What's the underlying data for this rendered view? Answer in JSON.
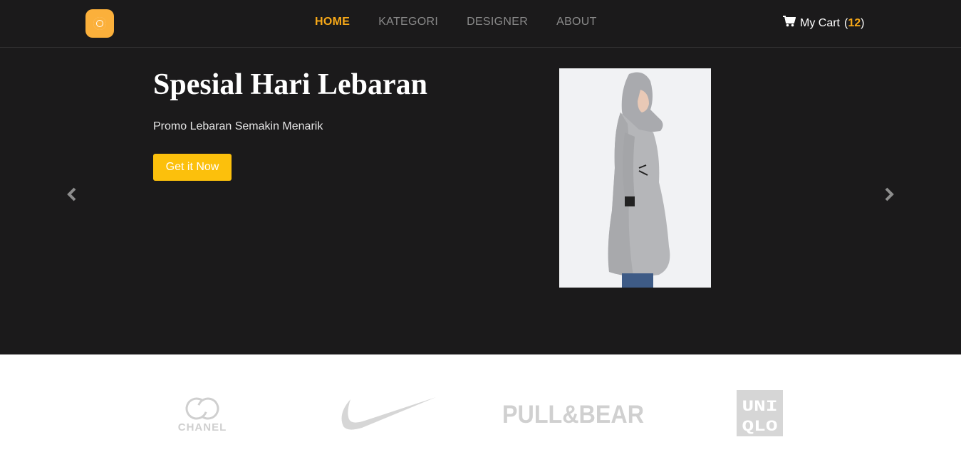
{
  "nav": {
    "items": [
      {
        "label": "HOME",
        "active": true
      },
      {
        "label": "KATEGORI",
        "active": false
      },
      {
        "label": "DESIGNER",
        "active": false
      },
      {
        "label": "ABOUT",
        "active": false
      }
    ],
    "cart_label": "My Cart",
    "cart_count": "12",
    "cart_open": "(",
    "cart_close": ")"
  },
  "hero": {
    "title": "Spesial Hari Lebaran",
    "subtitle": "Promo Lebaran Semakin Menarik",
    "cta_label": "Get it Now"
  },
  "brands": {
    "chanel": "CHANEL",
    "pullbear": "PULL&BEAR",
    "uniqlo_top": "UNI",
    "uniqlo_bottom": "QLO"
  },
  "colors": {
    "accent": "#f8a918",
    "button": "#fcc00c",
    "dark_bg": "#1b1a1b"
  },
  "icons": {
    "logo": "ring-logo-icon",
    "cart": "cart-icon",
    "prev": "chevron-left-icon",
    "next": "chevron-right-icon"
  }
}
